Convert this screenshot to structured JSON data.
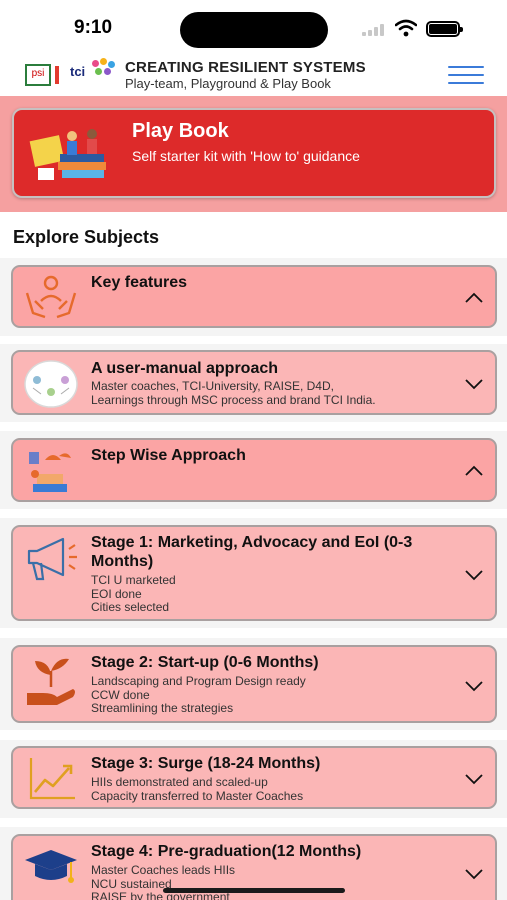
{
  "status_bar": {
    "time": "9:10"
  },
  "header": {
    "logo_psi": "psi",
    "logo_tci": "tci",
    "title": "CREATING RESILIENT SYSTEMS",
    "subtitle": "Play-team, Playground & Play Book"
  },
  "banner": {
    "title": "Play Book",
    "subtitle": "Self starter kit with 'How to' guidance"
  },
  "section_title": "Explore Subjects",
  "cards": [
    {
      "title": "Key features",
      "description": [],
      "icon": "hands-person-icon",
      "state": "expanded"
    },
    {
      "title": "A user-manual approach",
      "description": [
        "Master coaches, TCI-University, RAISE, D4D,",
        "Learnings through MSC process and brand TCI India."
      ],
      "icon": "user-manual-icon",
      "state": "collapsed"
    },
    {
      "title": "Step Wise Approach",
      "description": [],
      "icon": "step-wise-icon",
      "state": "expanded"
    },
    {
      "title": "Stage 1: Marketing, Advocacy and EoI (0-3 Months)",
      "description": [
        "TCI U marketed",
        "EOI done",
        "Cities selected"
      ],
      "icon": "megaphone-icon",
      "state": "collapsed"
    },
    {
      "title": "Stage 2: Start-up (0-6 Months)",
      "description": [
        "Landscaping and Program Design ready",
        "CCW done",
        "Streamlining the strategies"
      ],
      "icon": "plant-hand-icon",
      "state": "collapsed"
    },
    {
      "title": "Stage 3: Surge (18-24 Months)",
      "description": [
        "HIIs demonstrated and scaled-up",
        "Capacity transferred to Master Coaches"
      ],
      "icon": "growth-chart-icon",
      "state": "collapsed"
    },
    {
      "title": "Stage 4: Pre-graduation(12 Months)",
      "description": [
        "Master Coaches leads HIIs",
        "NCU sustained",
        "RAISE by the government"
      ],
      "icon": "graduation-cap-icon",
      "state": "collapsed"
    }
  ]
}
